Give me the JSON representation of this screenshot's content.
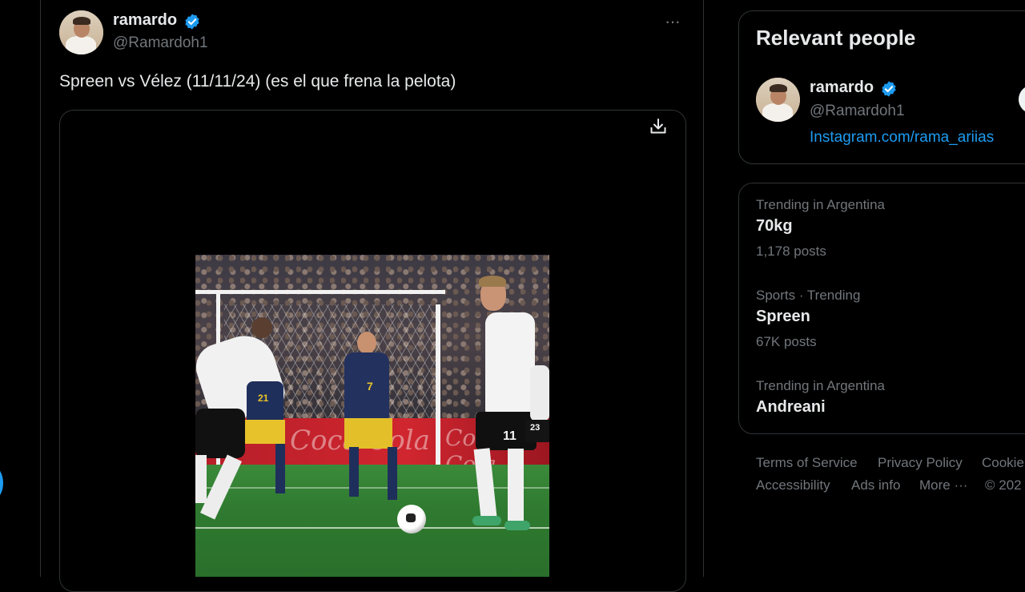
{
  "tweet": {
    "author_name": "ramardo",
    "author_handle": "@Ramardoh1",
    "text": "Spreen vs Vélez (11/11/24) (es el que frena la pelota)",
    "more_label": "···",
    "media": {
      "board_text": "Coca-Cola",
      "jerseys": [
        "7",
        "21",
        "11",
        "23"
      ]
    }
  },
  "relevant_people": {
    "title": "Relevant people",
    "person": {
      "name": "ramardo",
      "handle": "@Ramardoh1",
      "bio_link": "Instagram.com/rama_ariias"
    }
  },
  "trends": [
    {
      "meta": "Trending in Argentina",
      "name": "70kg",
      "count": "1,178 posts"
    },
    {
      "meta": "Sports · Trending",
      "name": "Spreen",
      "count": "67K posts"
    },
    {
      "meta": "Trending in Argentina",
      "name": "Andreani",
      "count": ""
    }
  ],
  "footer": {
    "row1": [
      "Terms of Service",
      "Privacy Policy",
      "Cookie"
    ],
    "row2": [
      "Accessibility",
      "Ads info",
      "More ···",
      "© 202"
    ]
  },
  "colors": {
    "background": "#000000",
    "text_primary": "#e7e9ea",
    "text_secondary": "#71767b",
    "accent": "#1d9bf0",
    "border": "#2f3336"
  }
}
